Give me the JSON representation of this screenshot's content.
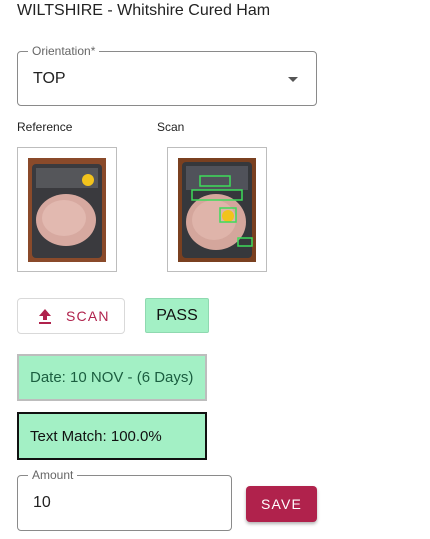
{
  "header": {
    "title": "WILTSHIRE - Whitshire Cured Ham"
  },
  "orientation": {
    "label": "Orientation*",
    "value": "TOP"
  },
  "images": {
    "reference_label": "Reference",
    "scan_label": "Scan"
  },
  "actions": {
    "scan_label": "SCAN",
    "save_label": "SAVE"
  },
  "status": {
    "result": "PASS"
  },
  "checks": {
    "date": "Date: 10 NOV - (6 Days)",
    "text_match": "Text Match: 100.0%"
  },
  "amount": {
    "label": "Amount",
    "value": "10"
  },
  "colors": {
    "accent": "#b0224c",
    "pass_bg": "#a3f0c5",
    "date_text": "#1b5e40"
  },
  "icons": {
    "scan": "upload-icon",
    "select": "chevron-down-icon"
  }
}
